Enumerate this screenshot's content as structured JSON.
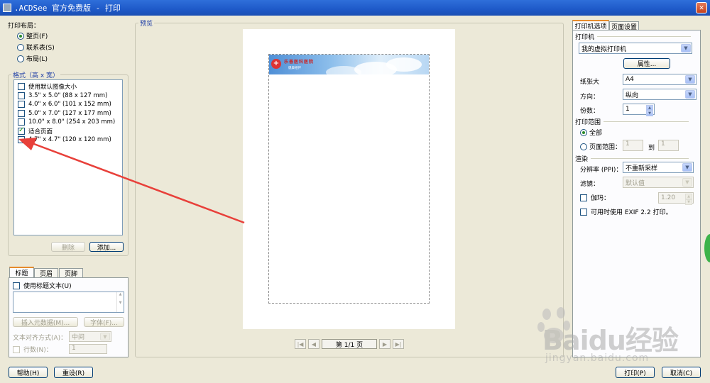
{
  "window": {
    "title": ".ACDSee 官方免费版 - 打印",
    "close": "✕"
  },
  "layout": {
    "label": "打印布局：",
    "options": [
      {
        "label": "整页(F)",
        "selected": true
      },
      {
        "label": "联系表(S)",
        "selected": false
      },
      {
        "label": "布局(L)",
        "selected": false
      }
    ]
  },
  "format": {
    "label": "格式（高 x 宽）",
    "items": [
      {
        "label": "使用默认图像大小",
        "checked": false
      },
      {
        "label": "3.5\" x 5.0\" (88 x 127 mm)",
        "checked": false
      },
      {
        "label": "4.0\" x 6.0\" (101 x 152 mm)",
        "checked": false
      },
      {
        "label": "5.0\" x 7.0\" (127 x 177 mm)",
        "checked": false
      },
      {
        "label": "10.0\" x 8.0\" (254 x 203 mm)",
        "checked": false
      },
      {
        "label": "适合页面",
        "checked": true
      },
      {
        "label": "4.7\" x 4.7\" (120 x 120 mm)",
        "checked": false
      }
    ],
    "delete_label": "删除",
    "add_label": "添加..."
  },
  "caption": {
    "tabs": [
      "标题",
      "页眉",
      "页脚"
    ],
    "use_caption_text": "使用标题文本(U)",
    "insert_metadata": "插入元数据(M)...",
    "font": "字体(F)...",
    "align_label": "文本对齐方式(A)：",
    "align_value": "中间",
    "lines_label": "行数(N)：",
    "lines_value": "1"
  },
  "preview": {
    "label": "预览",
    "page_indicator": "第 1/1 页",
    "banner_title": "乐善医科医院",
    "banner_subtitle": "健康相伴"
  },
  "right": {
    "tabs": [
      "打印机选项",
      "页面设置"
    ],
    "printer_section": "打印机",
    "printer_value": "我的虚拟打印机",
    "properties": "属性...",
    "paper_label": "纸张大",
    "paper_value": "A4",
    "orientation_label": "方向：",
    "orientation_value": "纵向",
    "copies_label": "份数：",
    "copies_value": "1",
    "range_section": "打印范围",
    "range_all": "全部",
    "range_pages": "页面范围：",
    "range_from": "1",
    "range_to_label": "到",
    "range_to": "1",
    "render_section": "渲染",
    "dpi_label": "分辨率 (PPI)：",
    "dpi_value": "不重新采样",
    "filter_label": "滤镜：",
    "filter_value": "默认值",
    "gamma_label": "伽玛：",
    "gamma_value": "1.20",
    "exif_label": "可用时使用 EXIF 2.2 打印。"
  },
  "bottom": {
    "help": "帮助(H)",
    "reset": "重设(R)",
    "print": "打印(P)",
    "cancel": "取消(C)"
  },
  "watermark": {
    "brand": "Baidu经验",
    "url": "jingyan.baidu.com"
  },
  "colors": {
    "arrow": "#e8403a",
    "title_bar": "#1e59c8",
    "tab_highlight": "#e68b2c"
  }
}
